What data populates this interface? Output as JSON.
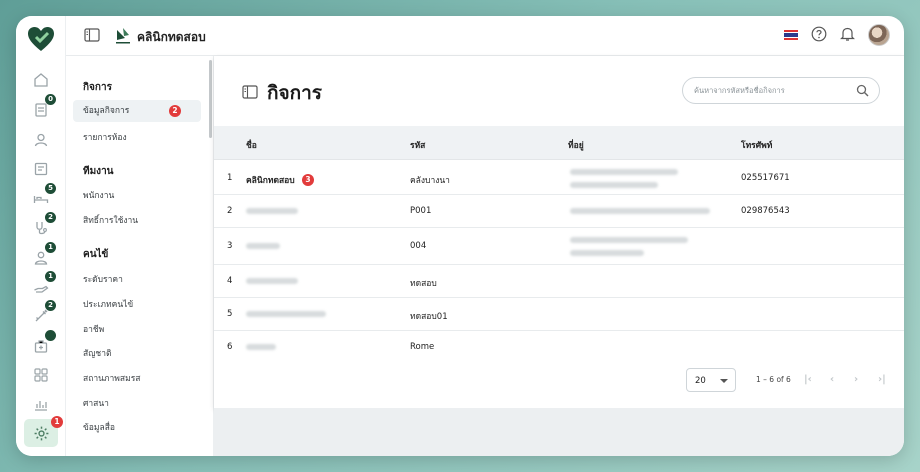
{
  "header": {
    "clinic_name": "คลินิกทดสอบ"
  },
  "rail_badges": {
    "b1": "0",
    "b2": "5",
    "b3": "2",
    "b4": "1",
    "b5": "1",
    "b6": "2",
    "settings": "1"
  },
  "submenu": {
    "sections": [
      {
        "title": "กิจการ",
        "items": [
          {
            "label": "ข้อมูลกิจการ",
            "badge": "2"
          },
          {
            "label": "รายการห้อง"
          }
        ]
      },
      {
        "title": "ทีมงาน",
        "items": [
          {
            "label": "พนักงาน"
          },
          {
            "label": "สิทธิ์การใช้งาน"
          }
        ]
      },
      {
        "title": "คนไข้",
        "items": [
          {
            "label": "ระดับราคา"
          },
          {
            "label": "ประเภทคนไข้"
          },
          {
            "label": "อาชีพ"
          },
          {
            "label": "สัญชาติ"
          },
          {
            "label": "สถานภาพสมรส"
          },
          {
            "label": "ศาสนา"
          },
          {
            "label": "ข้อมูลสื่อ"
          }
        ]
      }
    ]
  },
  "page": {
    "title": "กิจการ",
    "search_placeholder": "ค้นหาจากรหัสหรือชื่อกิจการ"
  },
  "table": {
    "columns": [
      "ชื่อ",
      "รหัส",
      "ที่อยู่",
      "โทรศัพท์"
    ],
    "rows": [
      {
        "no": "1",
        "name": "คลินิกทดสอบ",
        "badge": "3",
        "code": "คลังบางนา",
        "phone": "025517671"
      },
      {
        "no": "2",
        "name": "",
        "code": "P001",
        "phone": "029876543"
      },
      {
        "no": "3",
        "name": "",
        "code": "004",
        "phone": ""
      },
      {
        "no": "4",
        "name": "",
        "code": "ทดสอบ",
        "phone": ""
      },
      {
        "no": "5",
        "name": "",
        "code": "ทดสอบ01",
        "phone": ""
      },
      {
        "no": "6",
        "name": "",
        "code": "Rome",
        "phone": ""
      }
    ]
  },
  "pagination": {
    "page_size": "20",
    "range": "1 – 6 of 6"
  },
  "colors": {
    "brand": "#1e4d37",
    "badge_red": "#e23b3b",
    "active_bg": "#dcefe4"
  }
}
